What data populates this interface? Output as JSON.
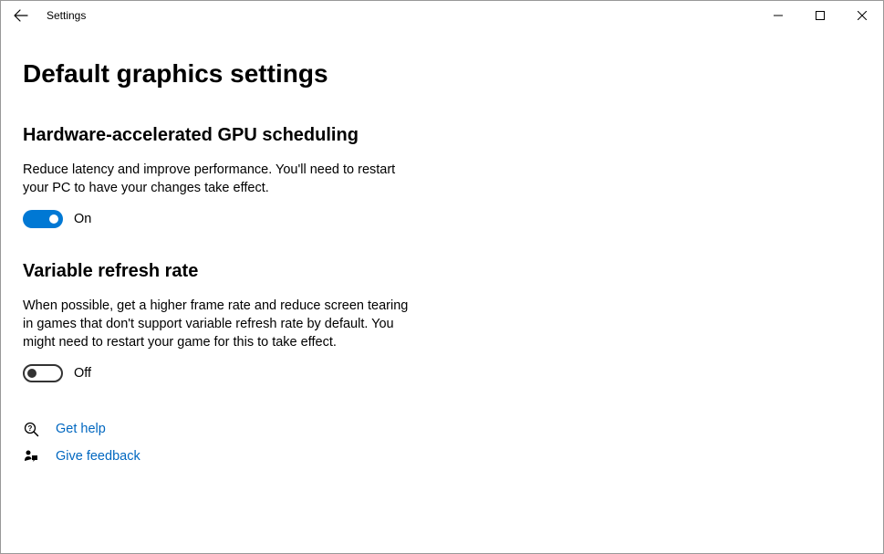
{
  "window": {
    "app_title": "Settings"
  },
  "page": {
    "title": "Default graphics settings"
  },
  "sections": {
    "gpu": {
      "heading": "Hardware-accelerated GPU scheduling",
      "description": "Reduce latency and improve performance. You'll need to restart your PC to have your changes take effect.",
      "toggle_state": "On"
    },
    "vrr": {
      "heading": "Variable refresh rate",
      "description": "When possible, get a higher frame rate and reduce screen tearing in games that don't support variable refresh rate by default. You might need to restart your game for this to take effect.",
      "toggle_state": "Off"
    }
  },
  "links": {
    "help": "Get help",
    "feedback": "Give feedback"
  }
}
